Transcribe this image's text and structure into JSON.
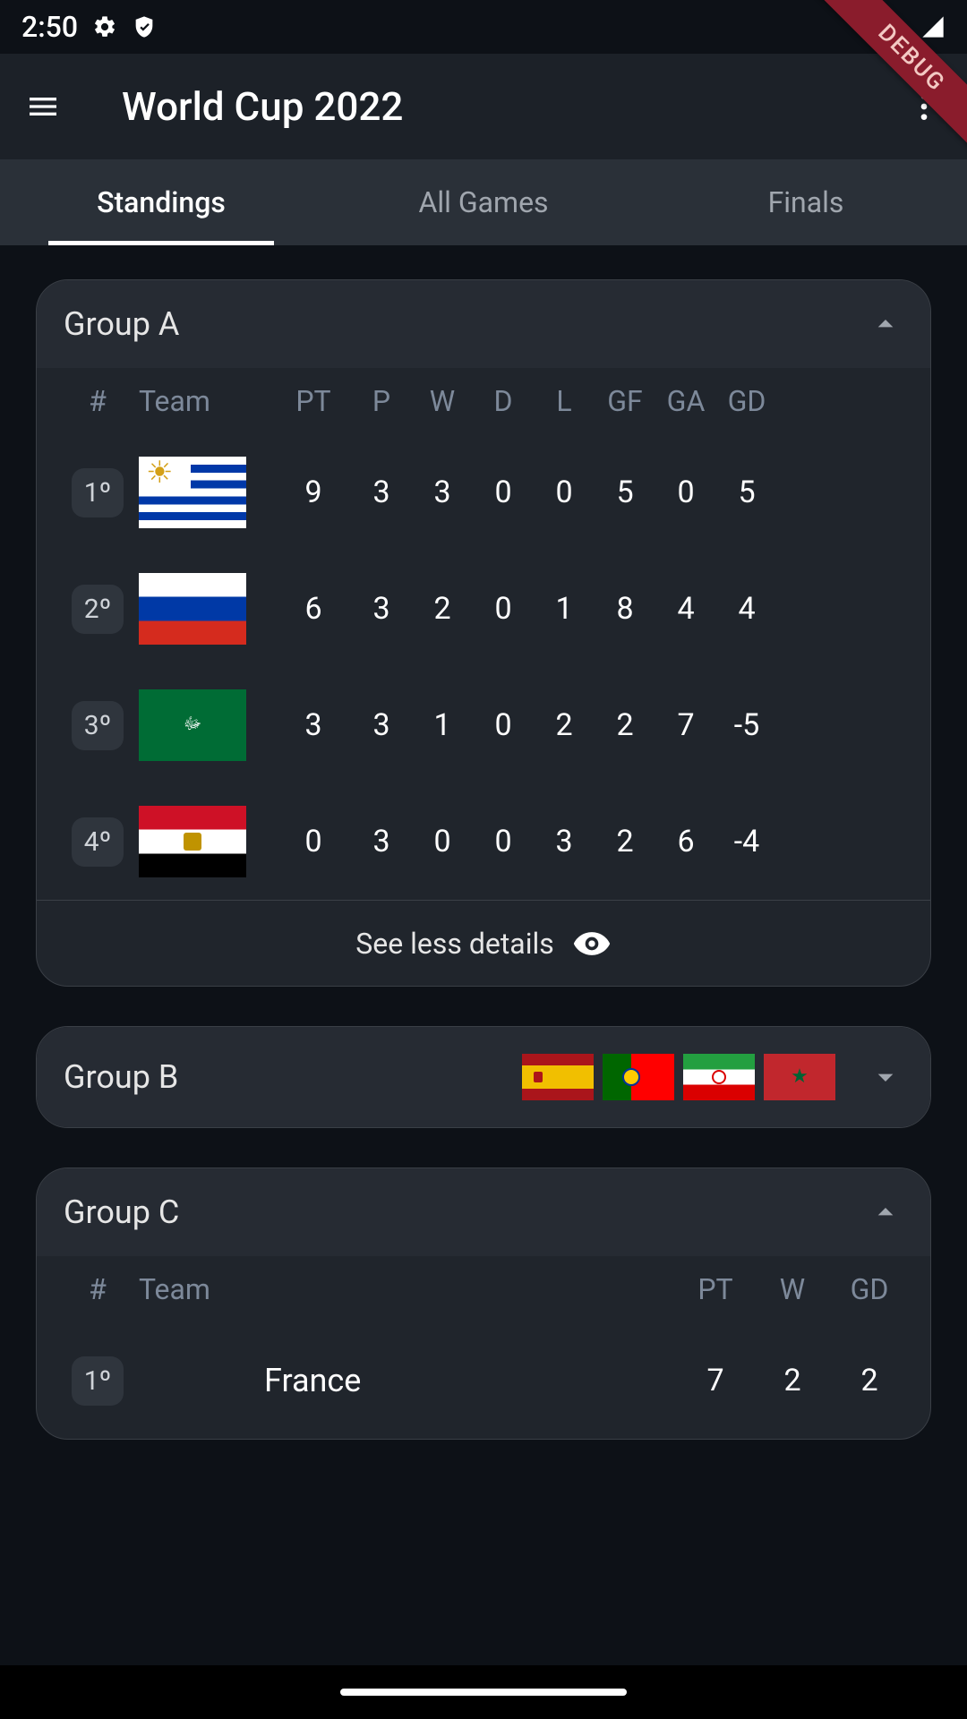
{
  "status": {
    "time": "2:50"
  },
  "debug_banner": "DEBUG",
  "app": {
    "title": "World Cup 2022"
  },
  "tabs": [
    {
      "label": "Standings",
      "active": true
    },
    {
      "label": "All Games",
      "active": false
    },
    {
      "label": "Finals",
      "active": false
    }
  ],
  "groups": {
    "a": {
      "title": "Group A",
      "headers": {
        "rank": "#",
        "team": "Team",
        "pt": "PT",
        "p": "P",
        "w": "W",
        "d": "D",
        "l": "L",
        "gf": "GF",
        "ga": "GA",
        "gd": "GD"
      },
      "rows": [
        {
          "rank": "1º",
          "flag": "uy",
          "pt": "9",
          "p": "3",
          "w": "3",
          "d": "0",
          "l": "0",
          "gf": "5",
          "ga": "0",
          "gd": "5"
        },
        {
          "rank": "2º",
          "flag": "ru",
          "pt": "6",
          "p": "3",
          "w": "2",
          "d": "0",
          "l": "1",
          "gf": "8",
          "ga": "4",
          "gd": "4"
        },
        {
          "rank": "3º",
          "flag": "sa",
          "pt": "3",
          "p": "3",
          "w": "1",
          "d": "0",
          "l": "2",
          "gf": "2",
          "ga": "7",
          "gd": "-5"
        },
        {
          "rank": "4º",
          "flag": "eg",
          "pt": "0",
          "p": "3",
          "w": "0",
          "d": "0",
          "l": "3",
          "gf": "2",
          "ga": "6",
          "gd": "-4"
        }
      ],
      "footer": "See less details"
    },
    "b": {
      "title": "Group B",
      "flags": [
        "es",
        "pt",
        "ir",
        "ma"
      ]
    },
    "c": {
      "title": "Group C",
      "headers": {
        "rank": "#",
        "team": "Team",
        "pt": "PT",
        "w": "W",
        "gd": "GD"
      },
      "rows": [
        {
          "rank": "1º",
          "flag": "fr",
          "name": "France",
          "pt": "7",
          "w": "2",
          "gd": "2"
        }
      ]
    }
  }
}
